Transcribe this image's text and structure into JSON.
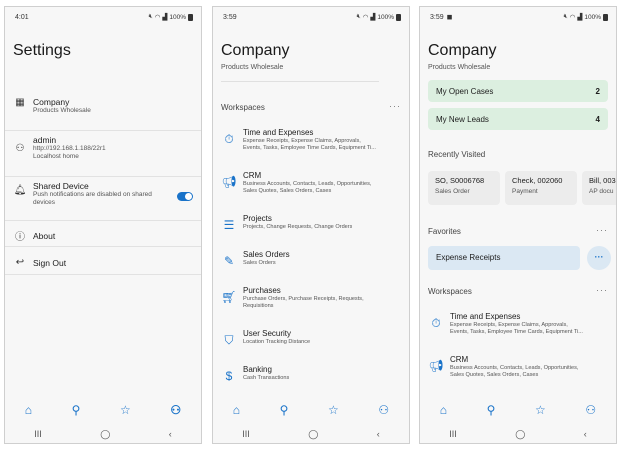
{
  "settings": {
    "status_time": "4:01",
    "status_battery": "100%",
    "title": "Settings",
    "company_label": "Company",
    "company_sub": "Products Wholesale",
    "user_label": "admin",
    "user_url": "http://192.168.1.188/22r1",
    "user_home": "Localhost home",
    "shared_label": "Shared Device",
    "shared_sub": "Push notifications are disabled on shared devices",
    "shared_on": true,
    "about_label": "About",
    "signout_label": "Sign Out"
  },
  "company": {
    "status_time": "3:59",
    "status_battery": "100%",
    "title": "Company",
    "subtitle": "Products Wholesale",
    "workspaces_label": "Workspaces",
    "workspaces": [
      {
        "icon": "stopwatch-icon",
        "title": "Time and Expenses",
        "desc": "Expense Receipts, Expense Claims, Approvals,\nEvents, Tasks, Employee Time Cards, Equipment Ti..."
      },
      {
        "icon": "megaphone-icon",
        "title": "CRM",
        "desc": "Business Accounts, Contacts, Leads, Opportunities,\nSales Quotes, Sales Orders, Cases"
      },
      {
        "icon": "gantt-icon",
        "title": "Projects",
        "desc": "Projects, Change Requests, Change Orders"
      },
      {
        "icon": "pencil-square-icon",
        "title": "Sales Orders",
        "desc": "Sales Orders"
      },
      {
        "icon": "cart-icon",
        "title": "Purchases",
        "desc": "Purchase Orders, Purchase Receipts, Requests,\nRequisitions"
      },
      {
        "icon": "shield-icon",
        "title": "User Security",
        "desc": "Location Tracking Distance"
      },
      {
        "icon": "dollar-icon",
        "title": "Banking",
        "desc": "Cash Transactions"
      }
    ]
  },
  "home": {
    "status_time": "3:59",
    "status_battery": "100%",
    "title": "Company",
    "subtitle": "Products Wholesale",
    "cases": [
      {
        "label": "My Open Cases",
        "count": "2"
      },
      {
        "label": "My New Leads",
        "count": "4"
      }
    ],
    "recently_visited_label": "Recently Visited",
    "recent": [
      {
        "title": "SO, S0006768",
        "sub": "Sales Order"
      },
      {
        "title": "Check, 002060",
        "sub": "Payment"
      },
      {
        "title": "Bill, 003",
        "sub": "AP docu"
      }
    ],
    "favorites_label": "Favorites",
    "favorite_item": "Expense Receipts",
    "favorite_more": "···",
    "workspaces_label": "Workspaces",
    "workspaces": [
      {
        "icon": "stopwatch-icon",
        "title": "Time and Expenses",
        "desc": "Expense Receipts, Expense Claims, Approvals,\nEvents, Tasks, Employee Time Cards, Equipment Ti..."
      },
      {
        "icon": "megaphone-icon",
        "title": "CRM",
        "desc": "Business Accounts, Contacts, Leads, Opportunities,\nSales Quotes, Sales Orders, Cases"
      }
    ]
  },
  "icons": {
    "home": "⌂",
    "search": "⚲",
    "star": "☆",
    "user": "⚇",
    "recents": "III",
    "homebtn": "◯",
    "back": "‹"
  },
  "colors": {
    "accent": "#1a73c9",
    "case_card": "#dcefe0",
    "favorite_chip": "#dbe8f3"
  }
}
